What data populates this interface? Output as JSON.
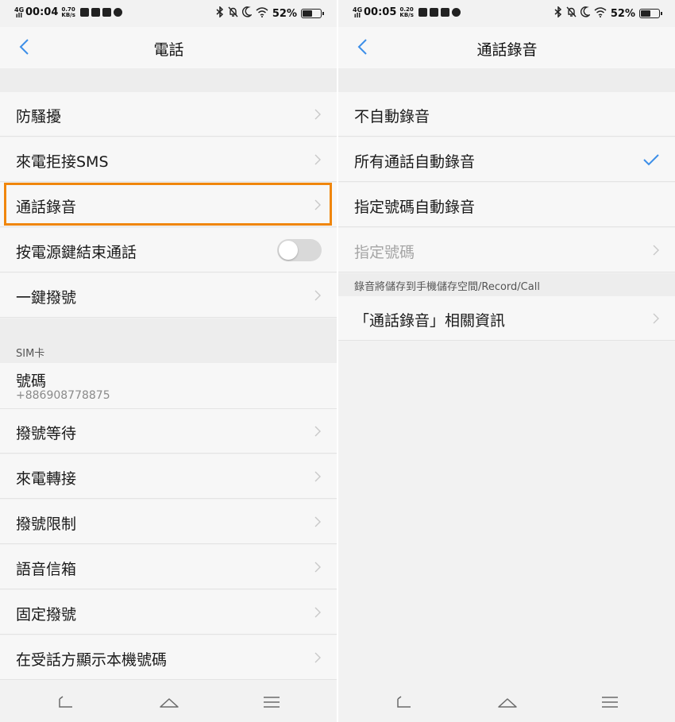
{
  "status_left": {
    "network": "4G",
    "signal": "ıll",
    "time": "00:04",
    "speed": "0.70",
    "speed_unit": "KB/s",
    "battery": "52%"
  },
  "status_right": {
    "network": "4G",
    "signal": "ıll",
    "time": "00:05",
    "speed": "0.20",
    "speed_unit": "KB/s",
    "battery": "52%"
  },
  "battery_level": 0.52,
  "icons": {
    "notifications": [
      "calendar-icon",
      "facebook-icon",
      "mic-icon",
      "messenger-icon"
    ],
    "status": [
      "bluetooth-icon",
      "bell-off-icon",
      "moon-icon",
      "wifi-icon",
      "battery-icon"
    ],
    "nav": [
      "back-nav-icon",
      "home-nav-icon",
      "menu-nav-icon"
    ]
  },
  "colors": {
    "accent": "#3d8fe8",
    "highlight": "#f0860c",
    "toggle_off": "#d9d9d9"
  },
  "left": {
    "title": "電話",
    "items": [
      {
        "label": "防騷擾"
      },
      {
        "label": "來電拒接SMS"
      },
      {
        "label": "通話錄音",
        "highlighted": true
      },
      {
        "label": "按電源鍵結束通話",
        "toggle": false
      },
      {
        "label": "一鍵撥號"
      }
    ],
    "sim_section": "SIM卡",
    "number_label": "號碼",
    "number_value": "+886908778875",
    "sim_items": [
      {
        "label": "撥號等待"
      },
      {
        "label": "來電轉接"
      },
      {
        "label": "撥號限制"
      },
      {
        "label": "語音信箱"
      },
      {
        "label": "固定撥號"
      },
      {
        "label": "在受話方顯示本機號碼"
      }
    ]
  },
  "right": {
    "title": "通話錄音",
    "options": [
      {
        "label": "不自動錄音",
        "checked": false
      },
      {
        "label": "所有通話自動錄音",
        "checked": true
      },
      {
        "label": "指定號碼自動錄音",
        "checked": false
      }
    ],
    "specified_numbers": "指定號碼",
    "storage_note": "錄音將儲存到手機儲存空間/Record/Call",
    "info_link": "「通話錄音」相關資訊"
  }
}
